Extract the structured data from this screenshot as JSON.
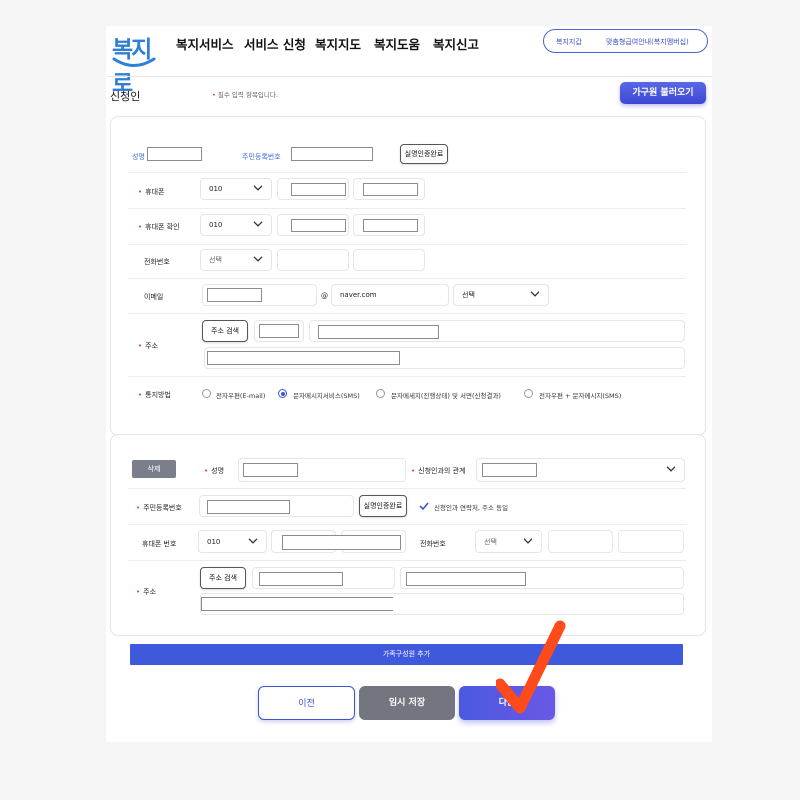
{
  "header": {
    "logo_text": "복지로",
    "nav": [
      "복지서비스",
      "서비스 신청",
      "복지지도",
      "복지도움",
      "복지신고"
    ],
    "pill_left": "복지지갑",
    "pill_right": "맞춤형급여안내(복지멤버십)"
  },
  "applicant": {
    "section_title": "신청인",
    "required_note": "필수 입력 항목입니다.",
    "family_load_button": "가구원 불러오기",
    "name_label": "성명",
    "rrn_label": "주민등록번호",
    "verify_button": "실명인증완료",
    "mobile_label": "휴대폰",
    "mobile_prefix": "010",
    "mobile_confirm_label": "휴대폰 확인",
    "mobile_confirm_prefix": "010",
    "phone_label": "전화번호",
    "phone_prefix": "선택",
    "email_label": "이메일",
    "email_at": "@",
    "email_domain": "naver.com",
    "email_domain_select": "선택",
    "address_label": "주소",
    "address_search_button": "주소 검색",
    "notify_label": "통지방법",
    "notify_options": [
      {
        "label": "전자우편(E-mail)",
        "selected": false
      },
      {
        "label": "문자메시지서비스(SMS)",
        "selected": true
      },
      {
        "label": "문자메세지(진행상태) 및 서면(신청결과)",
        "selected": false
      },
      {
        "label": "전자우편 + 문자메시지(SMS)",
        "selected": false
      }
    ]
  },
  "family_member": {
    "delete_button": "삭제",
    "name_label": "성명",
    "relation_label": "신청인과의 관계",
    "rrn_label": "주민등록번호",
    "verify_button": "실명인증완료",
    "same_address_checked": true,
    "same_address_text": "신청인과 연락처, 주소 동일",
    "mobile_label": "휴대폰 번호",
    "mobile_prefix": "010",
    "phone_label": "전화번호",
    "phone_prefix": "선택",
    "address_label": "주소",
    "address_search_button": "주소 검색"
  },
  "add_member_button": "가족구성원 추가",
  "footer": {
    "prev_button": "이전",
    "temp_save_button": "임시 저장",
    "next_button": "다음"
  },
  "colors": {
    "primary": "#3f59dc",
    "required_dot": "#e03c3c",
    "check_mark": "#ff4a1c",
    "gray_button": "#73767f"
  }
}
